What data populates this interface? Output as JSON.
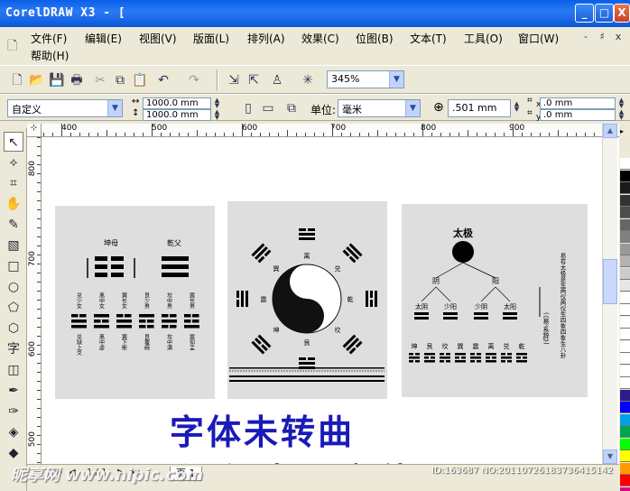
{
  "window": {
    "title": "CorelDRAW X3 - [",
    "min_label": "_",
    "max_label": "□",
    "close_label": "X"
  },
  "menu": {
    "items": [
      {
        "label": "文件(F)"
      },
      {
        "label": "编辑(E)"
      },
      {
        "label": "视图(V)"
      },
      {
        "label": "版面(L)"
      },
      {
        "label": "排列(A)"
      },
      {
        "label": "效果(C)"
      },
      {
        "label": "位图(B)"
      },
      {
        "label": "文本(T)"
      },
      {
        "label": "工具(O)"
      },
      {
        "label": "窗口(W)"
      }
    ],
    "help": "帮助(H)",
    "mdi": [
      "-",
      "♯",
      "x"
    ]
  },
  "toolbar": {
    "zoom": "345%"
  },
  "propbar": {
    "page_preset": "自定义",
    "width": "1000.0 mm",
    "height": "1000.0 mm",
    "units_label": "单位:",
    "units_value": "毫米",
    "nudge": ".501 mm",
    "dup_x": ".0 mm",
    "dup_y": ".0 mm",
    "x_label": "x",
    "y_label": "y"
  },
  "rulers": {
    "h_ticks": [
      "400",
      "500",
      "600",
      "700",
      "800",
      "900"
    ],
    "v_ticks": [
      "800",
      "700",
      "600",
      "500"
    ]
  },
  "artwork": {
    "panel1": {
      "headers": [
        "坤母",
        "乾父"
      ],
      "columns": [
        "兑少女",
        "离中女",
        "巽长女",
        "艮少男",
        "坎中男",
        "震长男"
      ],
      "bottoms": [
        "兑缺上爻",
        "离中虚",
        "巽下断",
        "艮覆碗",
        "坎中满",
        "震仰盂"
      ]
    },
    "panel2": {
      "labels": [
        "离",
        "兑",
        "乾",
        "坎",
        "艮",
        "坤",
        "震",
        "巽"
      ]
    },
    "panel3": {
      "top": "太极",
      "level2": [
        "阴",
        "阳"
      ],
      "level3": [
        "太阴",
        "少阳",
        "少阴",
        "太阳"
      ],
      "level4": [
        "坤",
        "艮",
        "坎",
        "巽",
        "震",
        "离",
        "兑",
        "乾"
      ],
      "side_note": "(《易·系辞》)",
      "right_text": "易有太极是生两仪两仪生四象四象生八卦"
    }
  },
  "overlay": {
    "line1": "字体未转曲",
    "line2": "汉仪中黑字体"
  },
  "bottom": {
    "page_label": "页 1",
    "counter": "1 / 1"
  },
  "watermark": {
    "left": "昵享网 www.nipic.com",
    "right": "ID:163687 NO:20110726183736415142"
  },
  "colors": {
    "title_bar": "#0b58d8",
    "overlay_text": "#1a1ab8",
    "canvas": "#ffffff",
    "panel": "#dedede"
  }
}
